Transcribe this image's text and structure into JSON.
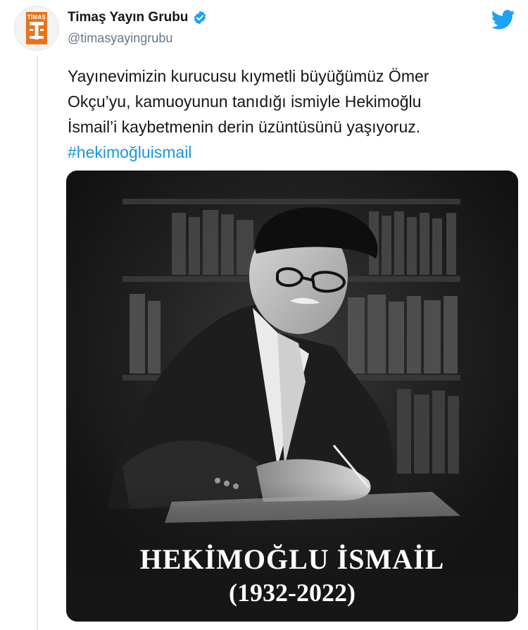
{
  "author": {
    "display_name": "Timaş Yayın Grubu",
    "handle": "@timasyayingrubu",
    "avatar_logo_text": "TİMAŞ",
    "verified": true,
    "verified_icon": "verified-badge-icon",
    "brand_color": "#e8731c"
  },
  "tweet": {
    "text_line1": "Yayınevimizin kurucusu kıymetli büyüğümüz Ömer",
    "text_line2": "Okçu’yu, kamuoyunun tanıdığı ismiyle Hekimoğlu",
    "text_line3": "İsmail’i kaybetmenin derin üzüntüsünü yaşıyoruz.",
    "hashtag": "#hekimoğluismail"
  },
  "media": {
    "title": "HEKİMOĞLU İSMAİL",
    "years": "(1932-2022)"
  },
  "icons": {
    "platform": "twitter-bird-icon",
    "platform_color": "#1da1f2",
    "hashtag_color": "#1b95e0"
  }
}
